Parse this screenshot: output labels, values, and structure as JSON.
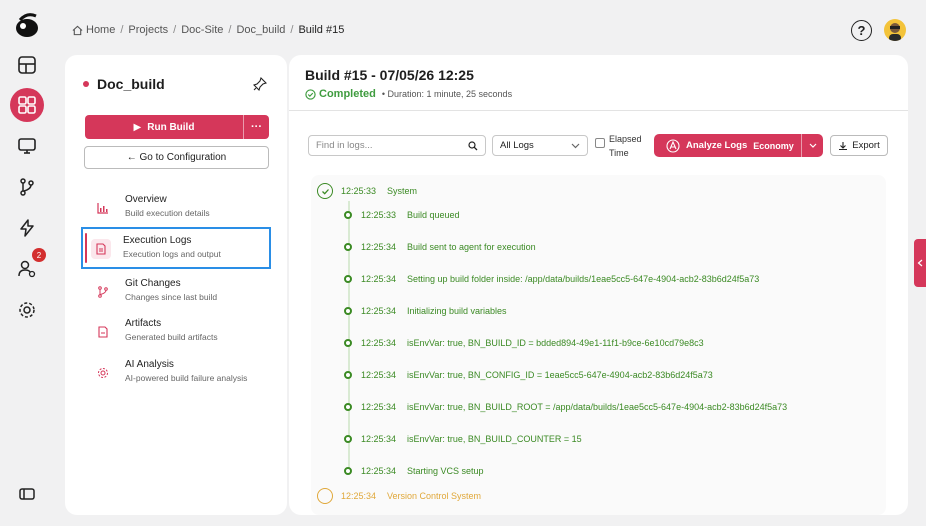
{
  "breadcrumb": {
    "items": [
      "Home",
      "Projects",
      "Doc-Site",
      "Doc_build"
    ],
    "current": "Build #15",
    "separator": "/"
  },
  "header": {
    "help_label": "?"
  },
  "rail": {
    "badge_count": "2",
    "items": [
      "dashboard-icon",
      "grid-icon",
      "monitor-icon",
      "branch-icon",
      "lightning-icon",
      "users-icon",
      "settings-icon",
      "sidebar-toggle-icon"
    ]
  },
  "left_panel": {
    "project_name": "Doc_build",
    "run_label": "Run Build",
    "more_label": "···",
    "config_label": "← Go to Configuration",
    "menu": [
      {
        "title": "Overview",
        "subtitle": "Build execution details"
      },
      {
        "title": "Execution Logs",
        "subtitle": "Execution logs and output"
      },
      {
        "title": "Git Changes",
        "subtitle": "Changes since last build"
      },
      {
        "title": "Artifacts",
        "subtitle": "Generated build artifacts"
      },
      {
        "title": "AI Analysis",
        "subtitle": "AI-powered build failure analysis"
      }
    ]
  },
  "main": {
    "title": "Build #15 - 07/05/26 12:25",
    "status": "Completed",
    "duration": "• Duration: 1 minute, 25 seconds",
    "search_placeholder": "Find in logs...",
    "filter_value": "All Logs",
    "elapsed_label_1": "Elapsed",
    "elapsed_label_2": "Time",
    "analyze_label": "Analyze Logs",
    "analyze_tier": "Economy",
    "export_label": "Export"
  },
  "logs": {
    "group": {
      "time": "12:25:33",
      "text": "System"
    },
    "entries": [
      {
        "time": "12:25:33",
        "text": "Build queued"
      },
      {
        "time": "12:25:34",
        "text": "Build sent to agent for execution"
      },
      {
        "time": "12:25:34",
        "text": "Setting up build folder inside: /app/data/builds/1eae5cc5-647e-4904-acb2-83b6d24f5a73"
      },
      {
        "time": "12:25:34",
        "text": "Initializing build variables"
      },
      {
        "time": "12:25:34",
        "text": "isEnvVar: true,  BN_BUILD_ID = bdded894-49e1-11f1-b9ce-6e10cd79e8c3"
      },
      {
        "time": "12:25:34",
        "text": "isEnvVar: true,  BN_CONFIG_ID = 1eae5cc5-647e-4904-acb2-83b6d24f5a73"
      },
      {
        "time": "12:25:34",
        "text": "isEnvVar: true,  BN_BUILD_ROOT = /app/data/builds/1eae5cc5-647e-4904-acb2-83b6d24f5a73"
      },
      {
        "time": "12:25:34",
        "text": "isEnvVar: true,  BN_BUILD_COUNTER = 15"
      },
      {
        "time": "12:25:34",
        "text": "Starting VCS setup"
      }
    ],
    "next_group": {
      "time": "12:25:34",
      "text": "Version Control System"
    }
  },
  "colors": {
    "accent": "#d5375a",
    "success": "#3b8a24",
    "selection": "#2a8ee6"
  }
}
